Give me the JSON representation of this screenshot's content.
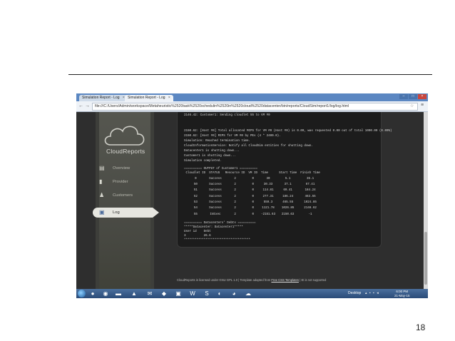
{
  "browser": {
    "tabs": [
      {
        "label": "Simulation Report - Log"
      },
      {
        "label": "Simulation Report - Log"
      }
    ],
    "url": "file:///C:/Users/Admin/workspace/Metaheuristic%2520task%2520schedulin%2520in%2520cloud%2520datacenter/bin/reports/CloudSim/report1/log/log.html"
  },
  "sidebar": {
    "logo_text": "CloudReports",
    "items": [
      {
        "label": "Overview"
      },
      {
        "label": "Provider"
      },
      {
        "label": "Customers"
      },
      {
        "label": "Log"
      }
    ]
  },
  "log": {
    "top_lines": [
      "2146.42: Customer1: Cloudlet 54 received",
      "2146.42: Customer1: Sending cloudlet 55 to VM #0"
    ],
    "mid_lines": [
      "2150.62: [Host #0] Total allocated MIPS for VM #0 (Host #0) is 0.00, was requested 0.00 out of total 1000.00 (0.00%)",
      "2150.62: [Host #0] MIPS for VM #0 by PEs (4 * 2400.0).",
      "Simulation: Reached termination time.",
      "CloudInformationService: Notify all CloudSim entities for shutting down.",
      "Datacenter1 is shutting down...",
      "Customer1 is shutting down...",
      "Simulation completed."
    ],
    "output_header": "========== OUTPUT of Customer1 ==========",
    "table_headers": [
      "Cloudlet ID",
      "STATUS",
      "Resource ID",
      "VM ID",
      "Time",
      "Start Time",
      "Finish Time"
    ],
    "rows": [
      [
        "0",
        "Success",
        "2",
        "0",
        "30",
        "5.1",
        "35.1"
      ],
      [
        "50",
        "Success",
        "2",
        "0",
        "30.33",
        "37.1",
        "67.41"
      ],
      [
        "51",
        "Success",
        "2",
        "0",
        "114.81",
        "69.41",
        "184.24"
      ],
      [
        "52",
        "Success",
        "2",
        "0",
        "277.31",
        "186.24",
        "463.55"
      ],
      [
        "53",
        "Success",
        "2",
        "0",
        "559.3",
        "465.55",
        "1024.85"
      ],
      [
        "54",
        "Success",
        "2",
        "0",
        "1121.78",
        "1026.85",
        "2148.62"
      ],
      [
        "55",
        "InExec",
        "2",
        "0",
        "-2151.63",
        "2150.63",
        "-1"
      ]
    ],
    "debt_lines": [
      "========== Datacenters' Debts ==========",
      "*****Datacenter: Datacenter1*****",
      "User id    Debt",
      "3          26.6",
      "*************************************"
    ]
  },
  "footer": {
    "prefix": "CloudReports is licensed under GNU GPL 1.0 | Template adapted from ",
    "link": "Free CSS Templates",
    "suffix": " | IE is not supported"
  },
  "taskbar": {
    "desktop_label": "Desktop",
    "time": "6:00 PM",
    "date": "21-May-15"
  },
  "slide_number": "18"
}
